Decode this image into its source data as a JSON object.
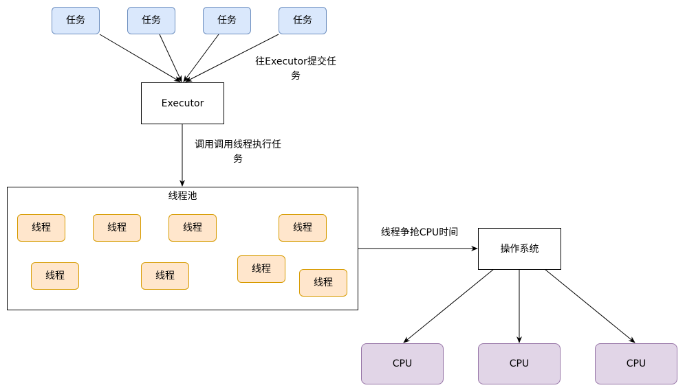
{
  "tasks": [
    "任务",
    "任务",
    "任务",
    "任务"
  ],
  "submit_label_line1": "往Executor提交任",
  "submit_label_line2": "务",
  "executor_label": "Executor",
  "invoke_label_line1": "调用调用线程执行任",
  "invoke_label_line2": "务",
  "pool_title": "线程池",
  "threads": [
    "线程",
    "线程",
    "线程",
    "线程",
    "线程",
    "线程",
    "线程",
    "线程"
  ],
  "compete_label": "线程争抢CPU时间",
  "os_label": "操作系统",
  "cpus": [
    "CPU",
    "CPU",
    "CPU"
  ],
  "colors": {
    "task_fill": "#dae8fc",
    "task_stroke": "#6c8ebf",
    "thread_fill": "#ffe6cc",
    "thread_stroke": "#d79b00",
    "cpu_fill": "#e1d5e7",
    "cpu_stroke": "#9673a6"
  }
}
